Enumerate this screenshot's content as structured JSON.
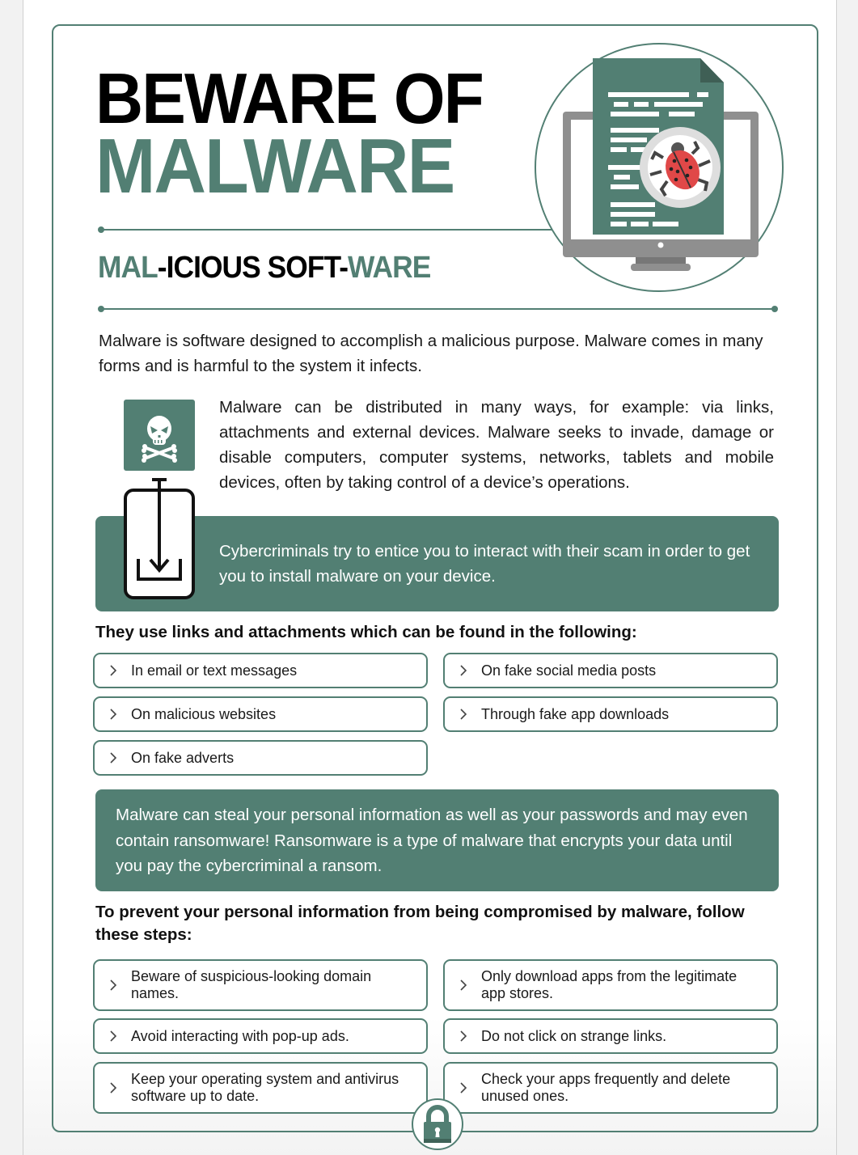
{
  "header": {
    "title_line1": "BEWARE OF",
    "title_line2": "MALWARE",
    "subtitle_parts": [
      {
        "text": "MAL",
        "accent": true
      },
      {
        "text": "-ICIOUS SOFT-",
        "accent": false
      },
      {
        "text": "WARE",
        "accent": true
      }
    ]
  },
  "colors": {
    "accent": "#527f73",
    "bug_red": "#e04848",
    "monitor_gray": "#8f8f8f"
  },
  "icons": {
    "hero": "monitor-document-bug-magnifier-icon",
    "skull": "skull-crossbones-icon",
    "download": "download-to-device-icon",
    "chevron": "chevron-right-icon",
    "lock": "padlock-icon"
  },
  "intro": "Malware is software designed to accomplish a malicious purpose. Malware comes in many forms and is harmful to the system it infects.",
  "distribution": "Malware can be distributed in many ways, for example: via links, attachments and external devices. Malware seeks to invade, damage or disable computers, computer systems, networks, tablets and mobile devices, often by taking control of a device’s operations.",
  "callout1": "Cybercriminals try to entice you to interact with their scam in order to get you to install malware on your device.",
  "sources": {
    "heading": "They use links and attachments which can be found in the following:",
    "items": [
      "In email or text messages",
      "On fake social media posts",
      "On malicious websites",
      "Through fake app downloads",
      "On fake adverts"
    ]
  },
  "callout2": "Malware can steal your personal information as well as your passwords and may even contain ransomware! Ransomware is a type of malware that encrypts your data until you pay the cybercriminal a ransom.",
  "steps": {
    "heading": "To prevent your personal information from being compromised by malware, follow these steps:",
    "items": [
      "Beware of suspicious-looking domain names.",
      "Only download apps from the legitimate app stores.",
      "Avoid interacting with pop-up ads.",
      "Do not click on strange links.",
      "Keep your operating system and antivirus software up to date.",
      "Check your apps frequently and delete unused ones."
    ]
  }
}
